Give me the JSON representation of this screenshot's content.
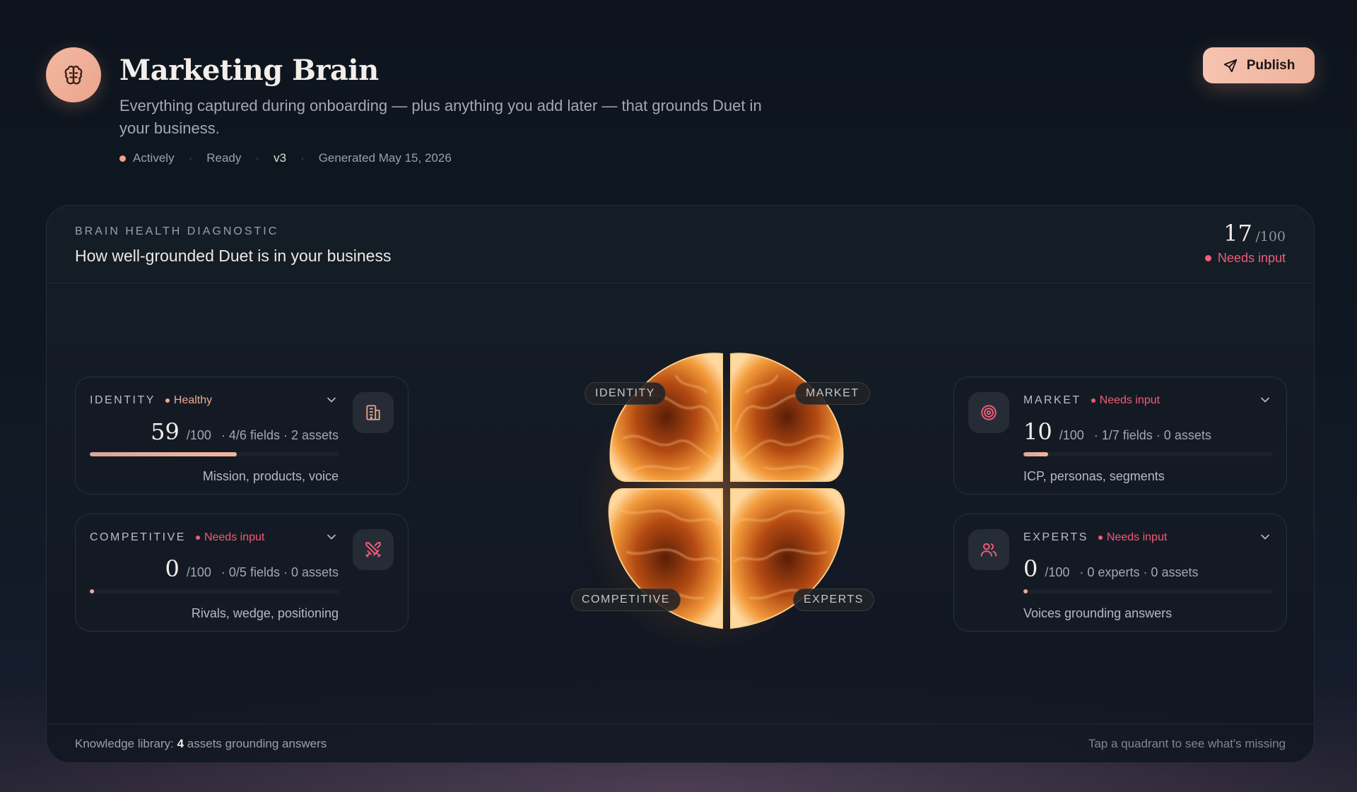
{
  "header": {
    "title": "Marketing Brain",
    "subtitle": "Everything captured during onboarding — plus anything you add later — that grounds Duet in your business.",
    "meta": {
      "status": "Actively",
      "state": "Ready",
      "version": "v3",
      "generated": "Generated May 15, 2026"
    },
    "publish_label": "Publish"
  },
  "diagnostic": {
    "eyebrow": "BRAIN HEALTH DIAGNOSTIC",
    "title": "How well-grounded Duet is in your business",
    "score": "17",
    "score_den": "/100",
    "status": "Needs input",
    "status_color": "#ef5d77"
  },
  "quadrants": {
    "identity": {
      "label": "IDENTITY",
      "status": "Healthy",
      "score": "59",
      "den": "/100",
      "info": "· 4/6 fields · 2 assets",
      "progress": 0.59,
      "desc": "Mission, products, voice",
      "icon": "building-icon"
    },
    "competitive": {
      "label": "COMPETITIVE",
      "status": "Needs input",
      "score": "0",
      "den": "/100",
      "info": "· 0/5 fields · 0 assets",
      "progress": 0.0,
      "desc": "Rivals, wedge, positioning",
      "icon": "swords-icon"
    },
    "market": {
      "label": "MARKET",
      "status": "Needs input",
      "score": "10",
      "den": "/100",
      "info": "· 1/7 fields · 0 assets",
      "progress": 0.1,
      "desc": "ICP, personas, segments",
      "icon": "target-icon"
    },
    "experts": {
      "label": "EXPERTS",
      "status": "Needs input",
      "score": "0",
      "den": "/100",
      "info": "· 0 experts · 0 assets",
      "progress": 0.0,
      "desc": "Voices grounding answers",
      "icon": "users-icon"
    }
  },
  "brain_labels": {
    "identity": "IDENTITY",
    "market": "MARKET",
    "competitive": "COMPETITIVE",
    "experts": "EXPERTS"
  },
  "footer": {
    "library_prefix": "Knowledge library:",
    "library_count": "4",
    "library_suffix": "assets grounding answers",
    "hint": "Tap a quadrant to see what's missing"
  },
  "colors": {
    "accent": "#f1a48c",
    "warning": "#ef5d77",
    "background": "#0f1822"
  }
}
